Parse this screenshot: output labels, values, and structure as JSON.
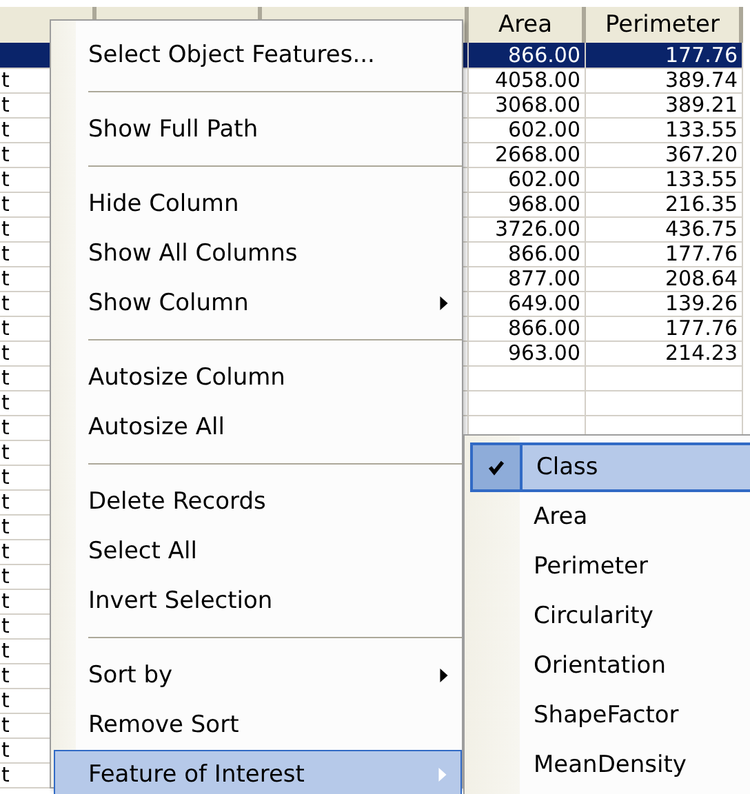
{
  "table": {
    "columns": [
      {},
      {},
      {},
      {
        "label": "Area"
      },
      {
        "label": "Perimeter"
      }
    ],
    "rows": [
      {
        "selected": true,
        "area": "866.00",
        "perimeter": "177.76"
      },
      {
        "selected": false,
        "column_1": "t",
        "area": "4058.00",
        "perimeter": "389.74"
      },
      {
        "selected": false,
        "column_1": "t",
        "area": "3068.00",
        "perimeter": "389.21"
      },
      {
        "selected": false,
        "column_1": "t",
        "area": "602.00",
        "perimeter": "133.55"
      },
      {
        "selected": false,
        "column_1": "t",
        "area": "2668.00",
        "perimeter": "367.20"
      },
      {
        "selected": false,
        "column_1": "t",
        "area": "602.00",
        "perimeter": "133.55"
      },
      {
        "selected": false,
        "column_1": "t",
        "area": "968.00",
        "perimeter": "216.35"
      },
      {
        "selected": false,
        "column_1": "t",
        "area": "3726.00",
        "perimeter": "436.75"
      },
      {
        "selected": false,
        "column_1": "t",
        "area": "866.00",
        "perimeter": "177.76"
      },
      {
        "selected": false,
        "column_1": "t",
        "area": "877.00",
        "perimeter": "208.64"
      },
      {
        "selected": false,
        "column_1": "t",
        "area": "649.00",
        "perimeter": "139.26"
      },
      {
        "selected": false,
        "column_1": "t",
        "area": "866.00",
        "perimeter": "177.76"
      },
      {
        "selected": false,
        "column_1": "t",
        "area": "963.00",
        "perimeter": "214.23"
      },
      {
        "selected": false,
        "column_1": "t"
      },
      {
        "selected": false,
        "column_1": "t"
      },
      {
        "selected": false,
        "column_1": "t"
      },
      {
        "selected": false,
        "column_1": "t"
      },
      {
        "selected": false,
        "column_1": "t"
      },
      {
        "selected": false,
        "column_1": "t"
      },
      {
        "selected": false,
        "column_1": "t"
      },
      {
        "selected": false,
        "column_1": "t"
      },
      {
        "selected": false,
        "column_1": "t"
      },
      {
        "selected": false,
        "column_1": "t"
      },
      {
        "selected": false,
        "column_1": "t"
      },
      {
        "selected": false,
        "column_1": "t"
      },
      {
        "selected": false,
        "column_1": "t"
      },
      {
        "selected": false,
        "column_1": "t"
      },
      {
        "selected": false,
        "column_1": "t"
      },
      {
        "selected": false,
        "column_1": "t"
      },
      {
        "selected": false,
        "column_1": "t"
      }
    ]
  },
  "context_menu": {
    "items": [
      {
        "kind": "item",
        "label": "Select Object Features...",
        "submenu": false,
        "selected": false
      },
      {
        "kind": "separator"
      },
      {
        "kind": "item",
        "label": "Show Full Path",
        "submenu": false,
        "selected": false
      },
      {
        "kind": "separator"
      },
      {
        "kind": "item",
        "label": "Hide Column",
        "submenu": false,
        "selected": false
      },
      {
        "kind": "item",
        "label": "Show All Columns",
        "submenu": false,
        "selected": false
      },
      {
        "kind": "item",
        "label": "Show Column",
        "submenu": true,
        "selected": false
      },
      {
        "kind": "separator"
      },
      {
        "kind": "item",
        "label": "Autosize Column",
        "submenu": false,
        "selected": false
      },
      {
        "kind": "item",
        "label": "Autosize All",
        "submenu": false,
        "selected": false
      },
      {
        "kind": "separator"
      },
      {
        "kind": "item",
        "label": "Delete Records",
        "submenu": false,
        "selected": false
      },
      {
        "kind": "item",
        "label": "Select All",
        "submenu": false,
        "selected": false
      },
      {
        "kind": "item",
        "label": "Invert Selection",
        "submenu": false,
        "selected": false
      },
      {
        "kind": "separator"
      },
      {
        "kind": "item",
        "label": "Sort by",
        "submenu": true,
        "selected": false
      },
      {
        "kind": "item",
        "label": "Remove Sort",
        "submenu": false,
        "selected": false
      },
      {
        "kind": "item",
        "label": "Feature of Interest",
        "submenu": true,
        "selected": true
      }
    ]
  },
  "submenu": {
    "items": [
      {
        "label": "Class",
        "checked": true,
        "selected": true
      },
      {
        "label": "Area",
        "checked": false,
        "selected": false
      },
      {
        "label": "Perimeter",
        "checked": false,
        "selected": false
      },
      {
        "label": "Circularity",
        "checked": false,
        "selected": false
      },
      {
        "label": "Orientation",
        "checked": false,
        "selected": false
      },
      {
        "label": "ShapeFactor",
        "checked": false,
        "selected": false
      },
      {
        "label": "MeanDensity",
        "checked": false,
        "selected": false
      }
    ]
  }
}
